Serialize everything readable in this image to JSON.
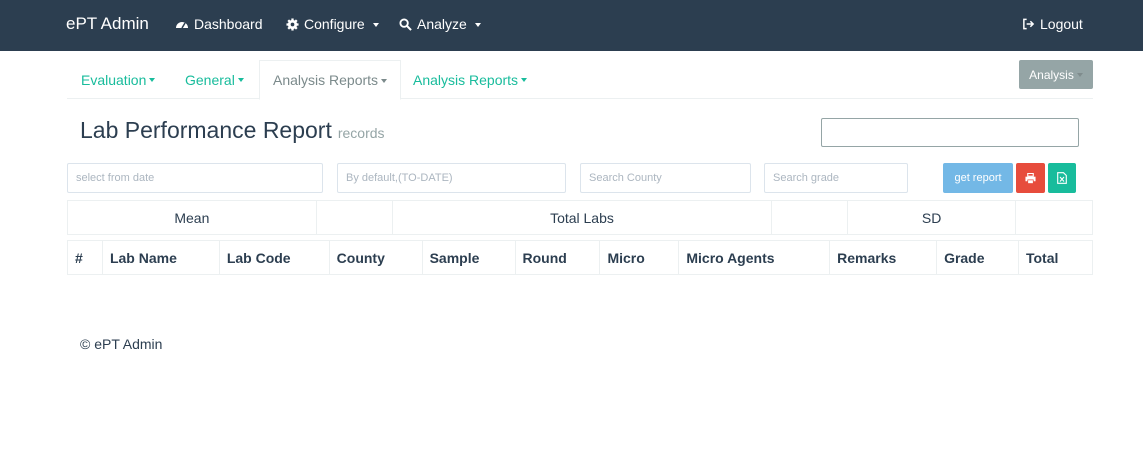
{
  "navbar": {
    "brand": "ePT Admin",
    "items": [
      {
        "label": "Dashboard",
        "icon": "dashboard-icon"
      },
      {
        "label": "Configure",
        "icon": "gear-icon"
      },
      {
        "label": "Analyze",
        "icon": "search-icon"
      }
    ],
    "logout": {
      "label": "Logout",
      "icon": "logout-icon"
    }
  },
  "tabs": [
    {
      "label": "Evaluation"
    },
    {
      "label": "General"
    },
    {
      "label": "Analysis Reports"
    },
    {
      "label": "Analysis Reports"
    }
  ],
  "analysis_button": "Analysis",
  "heading": {
    "title": "Lab Performance Report",
    "subtitle": "records"
  },
  "filters": {
    "from_date_placeholder": "select from date",
    "to_date_placeholder": "By default,(TO-DATE)",
    "county_placeholder": "Search County",
    "grade_placeholder": "Search grade"
  },
  "buttons": {
    "get_report": "get report",
    "print_icon": "print-icon",
    "excel_icon": "excel-icon"
  },
  "summary": {
    "mean": "Mean",
    "total_labs": "Total Labs",
    "sd": "SD"
  },
  "table": {
    "columns": [
      "#",
      "Lab Name",
      "Lab Code",
      "County",
      "Sample",
      "Round",
      "Micro",
      "Micro Agents",
      "Remarks",
      "Grade",
      "Total"
    ]
  },
  "footer": "© ePT Admin",
  "colors": {
    "navbar": "#2c3e50",
    "accent": "#18bc9c",
    "danger": "#e74c3c",
    "info": "#73b8e6"
  }
}
